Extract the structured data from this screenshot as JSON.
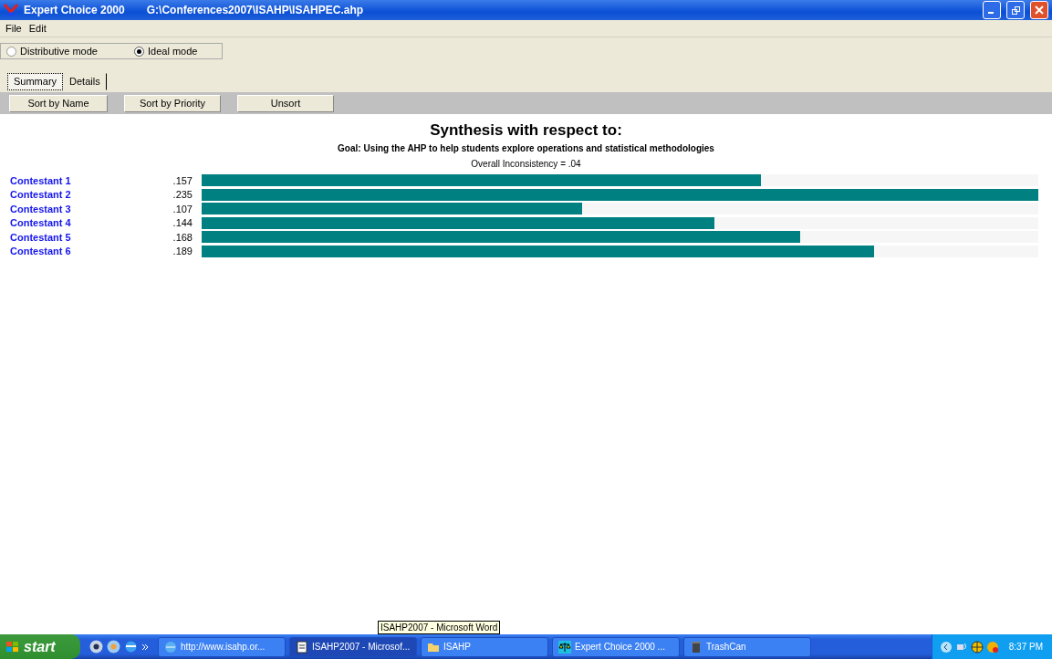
{
  "window": {
    "title": "Expert Choice 2000",
    "path": "G:\\Conferences2007\\ISAHP\\ISAHPEC.ahp"
  },
  "menu": [
    "File",
    "Edit"
  ],
  "modes": [
    {
      "label": "Distributive mode",
      "selected": false
    },
    {
      "label": "Ideal mode",
      "selected": true
    }
  ],
  "tabs": [
    {
      "label": "Summary",
      "selected": true
    },
    {
      "label": "Details",
      "selected": false
    }
  ],
  "buttons": [
    "Sort by Name",
    "Sort by Priority",
    "Unsort"
  ],
  "synthesis": {
    "heading": "Synthesis with respect to:",
    "goal": "Goal: Using the AHP to help students explore operations and statistical methodologies",
    "inconsistency": "Overall Inconsistency = .04"
  },
  "alternatives": [
    {
      "name": "Contestant 1",
      "value": ".157",
      "level": 0.668
    },
    {
      "name": "Contestant 2",
      "value": ".235",
      "level": 1.0
    },
    {
      "name": "Contestant 3",
      "value": ".107",
      "level": 0.455
    },
    {
      "name": "Contestant 4",
      "value": ".144",
      "level": 0.613
    },
    {
      "name": "Contestant 5",
      "value": ".168",
      "level": 0.715
    },
    {
      "name": "Contestant 6",
      "value": ".189",
      "level": 0.804
    }
  ],
  "tooltip": "ISAHP2007 - Microsoft Word",
  "taskbar": {
    "start": "start",
    "tasks": [
      {
        "label": "http://www.isahp.or...",
        "kind": "browser",
        "selected": false
      },
      {
        "label": "ISAHP2007 - Microsof...",
        "kind": "document",
        "selected": true
      },
      {
        "label": "ISAHP",
        "kind": "folder",
        "selected": false
      },
      {
        "label": "Expert Choice 2000   ...",
        "kind": "app",
        "selected": false
      },
      {
        "label": "TrashCan",
        "kind": "trash",
        "selected": false
      }
    ],
    "clock": "8:37 PM"
  }
}
